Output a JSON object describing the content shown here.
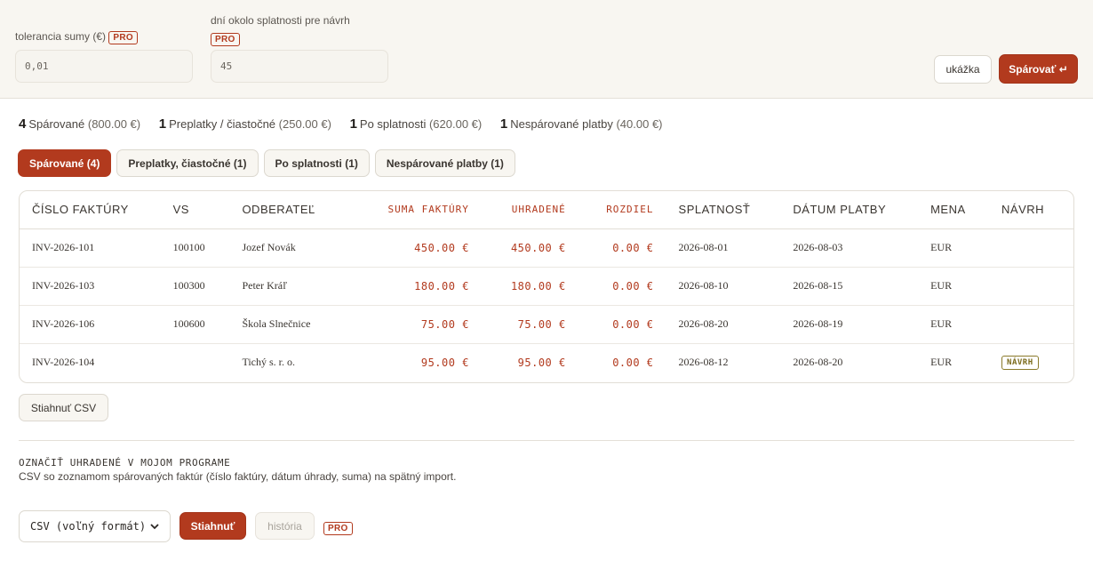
{
  "settings": {
    "tolerance_label": "tolerancia sumy (€)",
    "tolerance_value": "0,01",
    "days_label": "dní okolo splatnosti pre návrh",
    "days_value": "45",
    "pro_badge": "PRO",
    "preview_button": "ukážka",
    "match_button": "Spárovať ↵"
  },
  "summary": [
    {
      "count": "4",
      "label": "Spárované",
      "amount": "(800.00 €)"
    },
    {
      "count": "1",
      "label": "Preplatky / čiastočné",
      "amount": "(250.00 €)"
    },
    {
      "count": "1",
      "label": "Po splatnosti",
      "amount": "(620.00 €)"
    },
    {
      "count": "1",
      "label": "Nespárované platby",
      "amount": "(40.00 €)"
    }
  ],
  "tabs": [
    {
      "label": "Spárované (4)",
      "active": true
    },
    {
      "label": "Preplatky, čiastočné (1)",
      "active": false
    },
    {
      "label": "Po splatnosti (1)",
      "active": false
    },
    {
      "label": "Nespárované platby (1)",
      "active": false
    }
  ],
  "table": {
    "headers": [
      "ČÍSLO FAKTÚRY",
      "VS",
      "ODBERATEĽ",
      "SUMA FAKTÚRY",
      "UHRADENÉ",
      "ROZDIEL",
      "SPLATNOSŤ",
      "DÁTUM PLATBY",
      "MENA",
      "NÁVRH"
    ],
    "rows": [
      {
        "invoice": "INV-2026-101",
        "vs": "100100",
        "customer": "Jozef Novák",
        "amount": "450.00 €",
        "paid": "450.00 €",
        "diff": "0.00 €",
        "due": "2026-08-01",
        "paid_date": "2026-08-03",
        "currency": "EUR",
        "suggestion": ""
      },
      {
        "invoice": "INV-2026-103",
        "vs": "100300",
        "customer": "Peter Kráľ",
        "amount": "180.00 €",
        "paid": "180.00 €",
        "diff": "0.00 €",
        "due": "2026-08-10",
        "paid_date": "2026-08-15",
        "currency": "EUR",
        "suggestion": ""
      },
      {
        "invoice": "INV-2026-106",
        "vs": "100600",
        "customer": "Škola Slnečnice",
        "amount": "75.00 €",
        "paid": "75.00 €",
        "diff": "0.00 €",
        "due": "2026-08-20",
        "paid_date": "2026-08-19",
        "currency": "EUR",
        "suggestion": ""
      },
      {
        "invoice": "INV-2026-104",
        "vs": "",
        "customer": "Tichý s. r. o.",
        "amount": "95.00 €",
        "paid": "95.00 €",
        "diff": "0.00 €",
        "due": "2026-08-12",
        "paid_date": "2026-08-20",
        "currency": "EUR",
        "suggestion": "NÁVRH"
      }
    ]
  },
  "download_csv_button": "Stiahnuť CSV",
  "mark_paid": {
    "title": "OZNAČIŤ UHRADENÉ V MOJOM PROGRAME",
    "description": "CSV so zoznamom spárovaných faktúr (číslo faktúry, dátum úhrady, suma) na spätný import.",
    "format_selected": "CSV (voľný formát)",
    "download_button": "Stiahnuť",
    "history_button": "história",
    "pro_badge": "PRO"
  },
  "colors": {
    "accent": "#b23a1e",
    "panel_bg": "#f8f6f1",
    "suggestion_badge": "#7a6a1a"
  }
}
